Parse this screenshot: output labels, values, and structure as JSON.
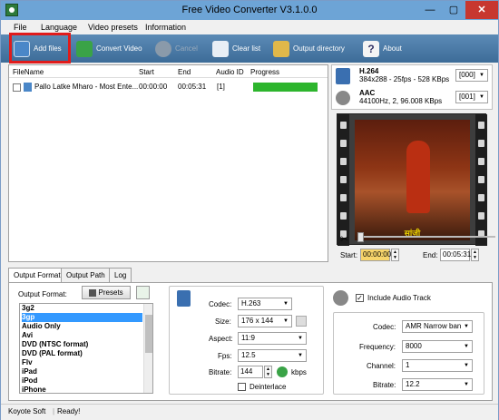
{
  "window": {
    "title": "Free Video Converter V3.1.0.0",
    "min": "—",
    "max": "▢",
    "close": "✕"
  },
  "menu": [
    "File",
    "Language",
    "Video presets",
    "Information"
  ],
  "toolbar": {
    "add": "Add files",
    "convert": "Convert Video",
    "cancel": "Cancel",
    "clear": "Clear list",
    "output": "Output directory",
    "about": "About"
  },
  "filelist": {
    "headers": {
      "name": "FileName",
      "start": "Start",
      "end": "End",
      "audio": "Audio ID",
      "progress": "Progress"
    },
    "rows": [
      {
        "name": "Pallo Latke Mharo - Most Ente...",
        "start": "00:00:00",
        "end": "00:05:31",
        "audio": "[1]",
        "progress": 1
      }
    ]
  },
  "video_track": {
    "codec": "H.264",
    "info": "384x288 - 25fps - 528 KBps",
    "id": "[000]"
  },
  "audio_track": {
    "codec": "AAC",
    "info": "44100Hz, 2, 96.008 KBps",
    "id": "[001]"
  },
  "trim": {
    "start_label": "Start:",
    "start": "00:00:00",
    "end_label": "End:",
    "end": "00:05:31"
  },
  "tabs": [
    "Output Format",
    "Output Path",
    "Log"
  ],
  "output_format": {
    "label": "Output Format:",
    "presets": "Presets",
    "items": [
      "3g2",
      "3gp",
      "Audio Only",
      "Avi",
      "DVD (NTSC format)",
      "DVD (PAL format)",
      "Flv",
      "iPad",
      "iPod",
      "iPhone"
    ],
    "selected": 1
  },
  "video_settings": {
    "codec_label": "Codec:",
    "codec": "H.263",
    "size_label": "Size:",
    "size": "176 x 144",
    "aspect_label": "Aspect:",
    "aspect": "11:9",
    "fps_label": "Fps:",
    "fps": "12.5",
    "bitrate_label": "Bitrate:",
    "bitrate": "144",
    "kbps": "kbps",
    "deinterlace": "Deinterlace"
  },
  "audio_settings": {
    "include": "Include Audio Track",
    "codec_label": "Codec:",
    "codec": "AMR Narrow ban",
    "freq_label": "Frequency:",
    "freq": "8000",
    "channel_label": "Channel:",
    "channel": "1",
    "bitrate_label": "Bitrate:",
    "bitrate": "12.2"
  },
  "preview_caption": "सांजी",
  "status": {
    "vendor": "Koyote Soft",
    "state": "Ready!"
  }
}
